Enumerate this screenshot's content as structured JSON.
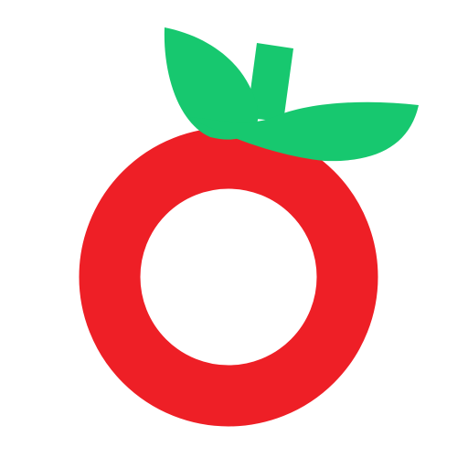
{
  "icon": {
    "name": "tomato-icon",
    "colors": {
      "background": "#ffffff",
      "fruit": "#ee1f26",
      "leaves": "#17c86f",
      "inner_hole": "#ffffff"
    }
  }
}
